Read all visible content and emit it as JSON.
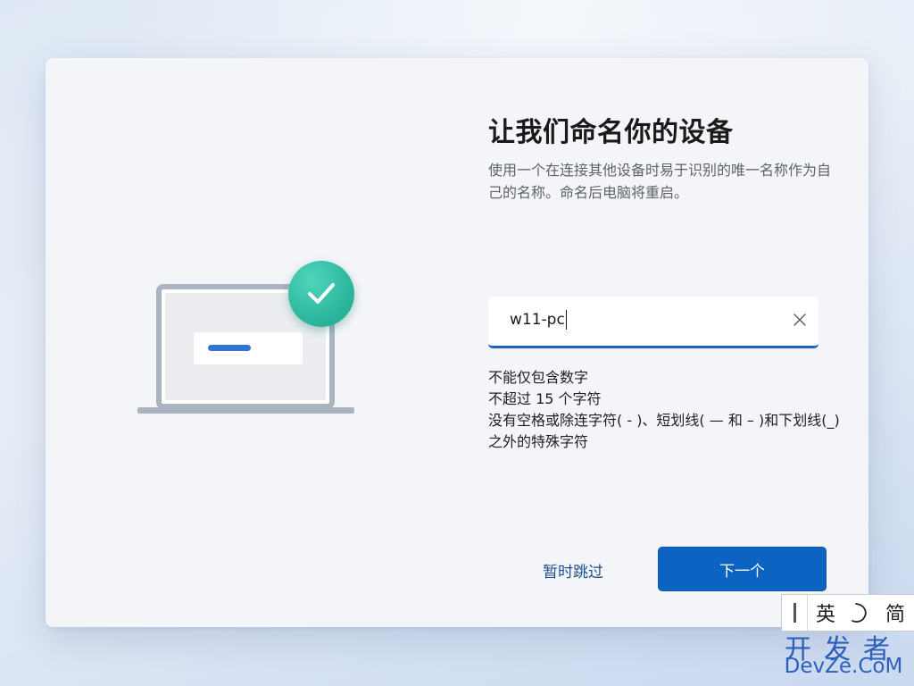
{
  "page": {
    "title": "让我们命名你的设备",
    "description": "使用一个在连接其他设备时易于识别的唯一名称作为自己的名称。命名后电脑将重启。"
  },
  "name_input": {
    "value": "w11-pc",
    "clear_icon": "close-icon"
  },
  "rules": [
    "不能仅包含数字",
    "不超过 15 个字符",
    "没有空格或除连字符( - )、短划线( — 和 – )和下划线(_)之外的特殊字符"
  ],
  "buttons": {
    "skip_label": "暂时跳过",
    "next_label": "下一个"
  },
  "ime_toolbar": {
    "language": "英",
    "mode_icon": "moon-icon",
    "charset": "简"
  },
  "watermark": {
    "line1": "开发者",
    "line2": "DevZe.CoM"
  },
  "colors": {
    "accent": "#0d63c2",
    "check_badge": "#2cb89f",
    "link": "#1a4f8e"
  }
}
